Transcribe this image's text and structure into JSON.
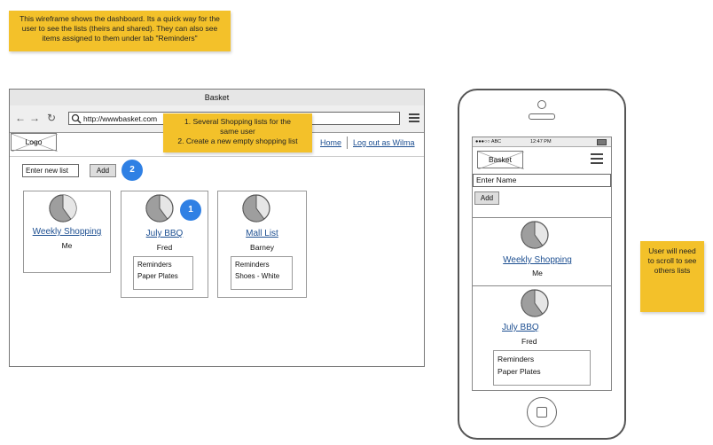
{
  "notes": {
    "top": "This wireframe shows the dashboard. Its a quick way for the user to see the lists (theirs and shared).  They can also see items assigned to them under tab \"Reminders\"",
    "middle_line1": "1. Several Shopping lists for the same user",
    "middle_line2": "2. Create a new empty shopping list",
    "right": "User will need to scroll to see others lists"
  },
  "browser": {
    "title": "Basket",
    "url": "http://wwwbasket.com",
    "logo": "Logo",
    "nav": {
      "home": "Home",
      "logout": "Log out as Wilma"
    },
    "new_list_placeholder": "Enter new list",
    "add_label": "Add",
    "badge_add": "2",
    "badge_list": "1",
    "lists": [
      {
        "name": "Weekly Shopping",
        "owner": "Me"
      },
      {
        "name": "July BBQ",
        "owner": "Fred",
        "reminders_label": "Reminders",
        "reminders_item": "Paper Plates"
      },
      {
        "name": "Mall List",
        "owner": "Barney",
        "reminders_label": "Reminders",
        "reminders_item": "Shoes - White"
      }
    ]
  },
  "phone": {
    "carrier": "●●●○○ ABC",
    "time": "12:47 PM",
    "logo": "Basket",
    "name_placeholder": "Enter Name",
    "add_label": "Add",
    "lists": [
      {
        "name": "Weekly Shopping",
        "owner": "Me"
      },
      {
        "name": "July BBQ",
        "owner": "Fred",
        "reminders_label": "Reminders",
        "reminders_item": "Paper Plates"
      }
    ]
  }
}
